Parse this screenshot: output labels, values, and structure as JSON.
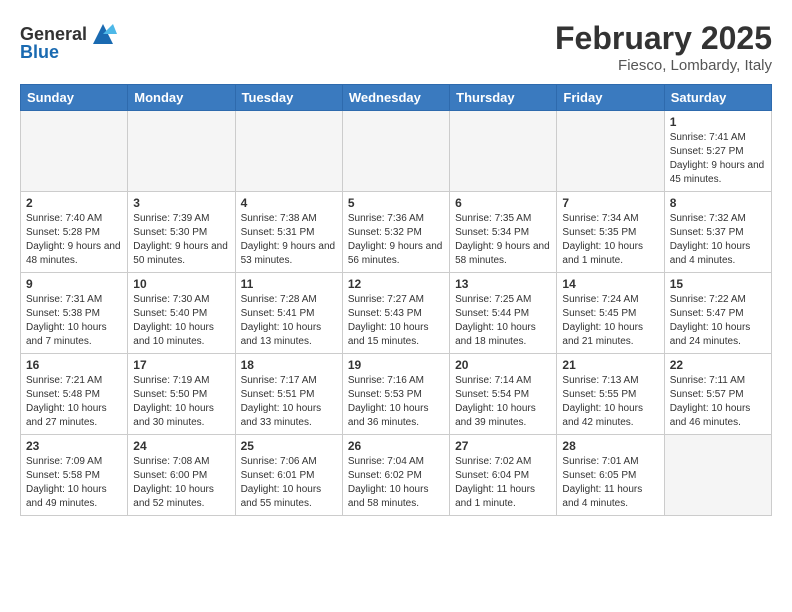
{
  "header": {
    "logo_general": "General",
    "logo_blue": "Blue",
    "month": "February 2025",
    "location": "Fiesco, Lombardy, Italy"
  },
  "days_of_week": [
    "Sunday",
    "Monday",
    "Tuesday",
    "Wednesday",
    "Thursday",
    "Friday",
    "Saturday"
  ],
  "weeks": [
    [
      {
        "day": "",
        "info": ""
      },
      {
        "day": "",
        "info": ""
      },
      {
        "day": "",
        "info": ""
      },
      {
        "day": "",
        "info": ""
      },
      {
        "day": "",
        "info": ""
      },
      {
        "day": "",
        "info": ""
      },
      {
        "day": "1",
        "info": "Sunrise: 7:41 AM\nSunset: 5:27 PM\nDaylight: 9 hours and 45 minutes."
      }
    ],
    [
      {
        "day": "2",
        "info": "Sunrise: 7:40 AM\nSunset: 5:28 PM\nDaylight: 9 hours and 48 minutes."
      },
      {
        "day": "3",
        "info": "Sunrise: 7:39 AM\nSunset: 5:30 PM\nDaylight: 9 hours and 50 minutes."
      },
      {
        "day": "4",
        "info": "Sunrise: 7:38 AM\nSunset: 5:31 PM\nDaylight: 9 hours and 53 minutes."
      },
      {
        "day": "5",
        "info": "Sunrise: 7:36 AM\nSunset: 5:32 PM\nDaylight: 9 hours and 56 minutes."
      },
      {
        "day": "6",
        "info": "Sunrise: 7:35 AM\nSunset: 5:34 PM\nDaylight: 9 hours and 58 minutes."
      },
      {
        "day": "7",
        "info": "Sunrise: 7:34 AM\nSunset: 5:35 PM\nDaylight: 10 hours and 1 minute."
      },
      {
        "day": "8",
        "info": "Sunrise: 7:32 AM\nSunset: 5:37 PM\nDaylight: 10 hours and 4 minutes."
      }
    ],
    [
      {
        "day": "9",
        "info": "Sunrise: 7:31 AM\nSunset: 5:38 PM\nDaylight: 10 hours and 7 minutes."
      },
      {
        "day": "10",
        "info": "Sunrise: 7:30 AM\nSunset: 5:40 PM\nDaylight: 10 hours and 10 minutes."
      },
      {
        "day": "11",
        "info": "Sunrise: 7:28 AM\nSunset: 5:41 PM\nDaylight: 10 hours and 13 minutes."
      },
      {
        "day": "12",
        "info": "Sunrise: 7:27 AM\nSunset: 5:43 PM\nDaylight: 10 hours and 15 minutes."
      },
      {
        "day": "13",
        "info": "Sunrise: 7:25 AM\nSunset: 5:44 PM\nDaylight: 10 hours and 18 minutes."
      },
      {
        "day": "14",
        "info": "Sunrise: 7:24 AM\nSunset: 5:45 PM\nDaylight: 10 hours and 21 minutes."
      },
      {
        "day": "15",
        "info": "Sunrise: 7:22 AM\nSunset: 5:47 PM\nDaylight: 10 hours and 24 minutes."
      }
    ],
    [
      {
        "day": "16",
        "info": "Sunrise: 7:21 AM\nSunset: 5:48 PM\nDaylight: 10 hours and 27 minutes."
      },
      {
        "day": "17",
        "info": "Sunrise: 7:19 AM\nSunset: 5:50 PM\nDaylight: 10 hours and 30 minutes."
      },
      {
        "day": "18",
        "info": "Sunrise: 7:17 AM\nSunset: 5:51 PM\nDaylight: 10 hours and 33 minutes."
      },
      {
        "day": "19",
        "info": "Sunrise: 7:16 AM\nSunset: 5:53 PM\nDaylight: 10 hours and 36 minutes."
      },
      {
        "day": "20",
        "info": "Sunrise: 7:14 AM\nSunset: 5:54 PM\nDaylight: 10 hours and 39 minutes."
      },
      {
        "day": "21",
        "info": "Sunrise: 7:13 AM\nSunset: 5:55 PM\nDaylight: 10 hours and 42 minutes."
      },
      {
        "day": "22",
        "info": "Sunrise: 7:11 AM\nSunset: 5:57 PM\nDaylight: 10 hours and 46 minutes."
      }
    ],
    [
      {
        "day": "23",
        "info": "Sunrise: 7:09 AM\nSunset: 5:58 PM\nDaylight: 10 hours and 49 minutes."
      },
      {
        "day": "24",
        "info": "Sunrise: 7:08 AM\nSunset: 6:00 PM\nDaylight: 10 hours and 52 minutes."
      },
      {
        "day": "25",
        "info": "Sunrise: 7:06 AM\nSunset: 6:01 PM\nDaylight: 10 hours and 55 minutes."
      },
      {
        "day": "26",
        "info": "Sunrise: 7:04 AM\nSunset: 6:02 PM\nDaylight: 10 hours and 58 minutes."
      },
      {
        "day": "27",
        "info": "Sunrise: 7:02 AM\nSunset: 6:04 PM\nDaylight: 11 hours and 1 minute."
      },
      {
        "day": "28",
        "info": "Sunrise: 7:01 AM\nSunset: 6:05 PM\nDaylight: 11 hours and 4 minutes."
      },
      {
        "day": "",
        "info": ""
      }
    ]
  ]
}
